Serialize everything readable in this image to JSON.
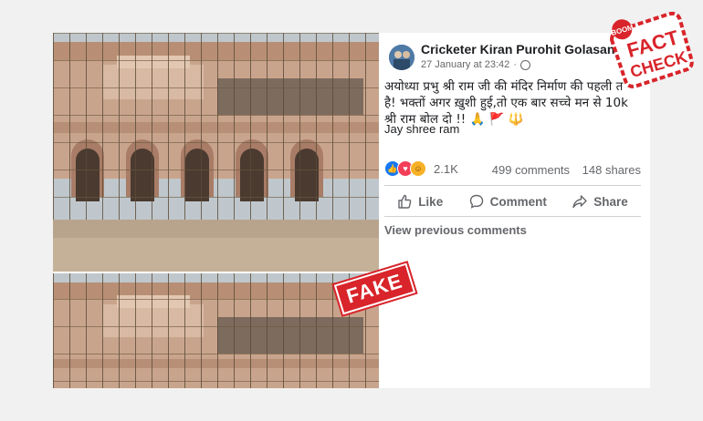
{
  "post": {
    "author": "Cricketer Kiran Purohit Golasan",
    "date": "27 January at 23:42",
    "privacy_icon": "globe-icon",
    "text_lines": [
      "अयोध्या प्रभु श्री राम जी की मंदिर निर्माण की पहली त",
      "है! भक्तों अगर ख़ुशी हुई,तो एक बार सच्चे मन से 10k",
      "श्री राम बोल दो !!"
    ],
    "text_emoji": "🙏 🚩 🔱",
    "footer_text": "Jay shree ram"
  },
  "engagement": {
    "reactions_count": "2.1K",
    "comments": "499 comments",
    "shares": "148 shares"
  },
  "actions": {
    "like": "Like",
    "comment": "Comment",
    "share": "Share"
  },
  "comments_link": "View previous comments",
  "stamps": {
    "fake": "FAKE",
    "badge_top": "BOOM",
    "badge_line1": "FACT",
    "badge_line2": "CHECK"
  },
  "colors": {
    "fake_red": "#d8242a",
    "facebook_blue": "#1877f2"
  }
}
